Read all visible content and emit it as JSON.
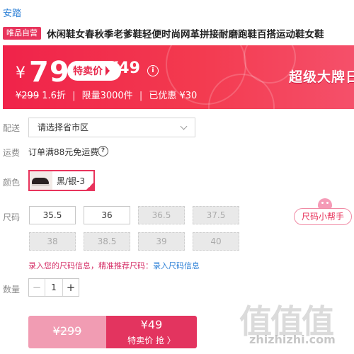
{
  "brand": "安踏",
  "product": {
    "badge": "唯品自营",
    "title": "休闲鞋女春秋季老爹鞋轻便时尚网革拼接耐磨跑鞋百搭运动鞋女鞋"
  },
  "price_banner": {
    "currency": "¥",
    "price": "79",
    "sale_label": "特卖价",
    "sale_price": "¥49",
    "promo_text": "超级大牌日",
    "original_price": "¥299",
    "discount": "1.6折",
    "limit": "限量3000件",
    "saved": "已优惠 ¥30",
    "separator": "|"
  },
  "delivery": {
    "label": "配送",
    "placeholder": "请选择省市区"
  },
  "freight": {
    "label": "运费",
    "text": "订单满88元免运费"
  },
  "color": {
    "label": "颜色",
    "selected": "黑/银-3"
  },
  "size": {
    "label": "尺码",
    "options": [
      {
        "value": "35.5",
        "available": true
      },
      {
        "value": "36",
        "available": true
      },
      {
        "value": "36.5",
        "available": false
      },
      {
        "value": "37.5",
        "available": false
      },
      {
        "value": "38",
        "available": false
      },
      {
        "value": "38.5",
        "available": false
      },
      {
        "value": "39",
        "available": false
      },
      {
        "value": "40",
        "available": false
      }
    ],
    "helper_label": "尺码小帮手",
    "info_text": "录入您的尺码信息，精准推荐尺码：",
    "info_link": "录入尺码信息"
  },
  "quantity": {
    "label": "数量",
    "value": "1",
    "minus": "−",
    "plus": "+"
  },
  "buy": {
    "original_price": "¥299",
    "sale_price": "¥49",
    "action_label": "特卖价 抢 〉"
  },
  "watermark": {
    "logo": "值值值",
    "url": "zhizhizhi.com"
  },
  "colors": {
    "accent": "#e8345c",
    "link": "#2b7fd6",
    "banner": "#f0234a"
  }
}
